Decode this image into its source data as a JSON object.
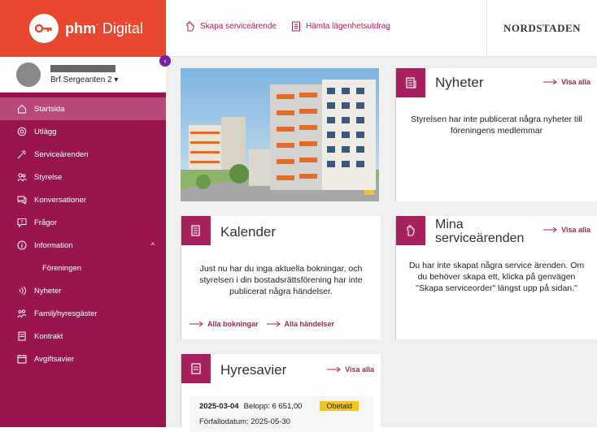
{
  "brand": {
    "name_bold": "phm",
    "name_light": "Digital"
  },
  "toplinks": [
    {
      "label": "Skapa serviceärende",
      "icon": "hand-icon"
    },
    {
      "label": "Hämta lägenhetsutdrag",
      "icon": "document-icon"
    }
  ],
  "partner_logo": "NORDSTADEN",
  "user": {
    "association": "Brf Sergeanten 2 ▾"
  },
  "collapse": "‹",
  "menu": [
    {
      "label": "Startsida",
      "icon": "home-icon",
      "active": true
    },
    {
      "label": "Utlägg",
      "icon": "coin-icon"
    },
    {
      "label": "Serviceärenden",
      "icon": "service-icon"
    },
    {
      "label": "Styrelse",
      "icon": "group-icon"
    },
    {
      "label": "Konversationer",
      "icon": "chat-icon"
    },
    {
      "label": "Frågor",
      "icon": "question-icon"
    },
    {
      "label": "Information",
      "icon": "info-icon",
      "chevron": "^"
    },
    {
      "label": "Föreningen",
      "sub": true
    },
    {
      "label": "Nyheter",
      "icon": "news-icon"
    },
    {
      "label": "Familj/hyresgäster",
      "icon": "family-icon"
    },
    {
      "label": "Kontrakt",
      "icon": "contract-icon"
    },
    {
      "label": "Avgiftsavier",
      "icon": "calendar-icon"
    }
  ],
  "news": {
    "title": "Nyheter",
    "visa_alla": "Visa alla",
    "body": "Styrelsen har inte publicerat några nyheter till föreningens medlemmar"
  },
  "calendar": {
    "title": "Kalender",
    "body": "Just nu har du inga aktuella bokningar, och styrelsen i din bostadsrättsförening har inte publicerat några händelser.",
    "link_bookings": "Alla bokningar",
    "link_events": "Alla händelser"
  },
  "service": {
    "title_line1": "Mina",
    "title_line2": "serviceärenden",
    "visa_alla": "Visa alla",
    "body": "Du har inte skapat några service ärenden. Om du behöver skapa ett, klicka på genvägen \"Skapa serviceorder\" längst upp på sidan.\""
  },
  "invoices": {
    "title": "Hyresavier",
    "visa_alla": "Visa alla",
    "date": "2025-03-04",
    "amount": "Belopp: 6 651,00",
    "status": "Obetald",
    "due": "Förfallodatum: 2025-05-30"
  },
  "colors": {
    "brand": "#e8482f",
    "sidebar": "#98154f",
    "accent": "#a8215f",
    "badge": "#f5c518"
  }
}
